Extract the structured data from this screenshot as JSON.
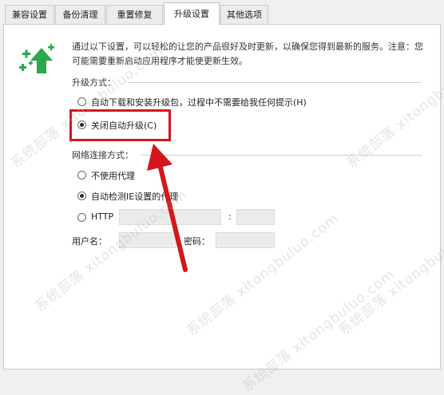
{
  "tabs": [
    {
      "label": "兼容设置"
    },
    {
      "label": "备份清理"
    },
    {
      "label": "重置修复"
    },
    {
      "label": "升级设置"
    },
    {
      "label": "其他选项"
    }
  ],
  "active_tab": "升级设置",
  "description": "通过以下设置，可以轻松的让您的产品很好及时更新，以确保您得到最新的服务。注意：您可能需要重新启动应用程序才能使更新生效。",
  "upgrade": {
    "title": "升级方式：",
    "options": [
      {
        "label": "自动下载和安装升级包，过程中不需要给我任何提示(H)",
        "checked": false
      },
      {
        "label": "关闭自动升级(C)",
        "checked": true
      }
    ]
  },
  "network": {
    "title": "网络连接方式：",
    "options": [
      {
        "label": "不使用代理",
        "checked": false
      },
      {
        "label": "自动检测IE设置的代理",
        "checked": true
      },
      {
        "label": "HTTP",
        "checked": false
      }
    ],
    "port_separator": ":",
    "username_label": "用户名：",
    "password_label": "密码："
  },
  "watermark": "系统部落 xitongbuluo.com",
  "colors": {
    "accent_green": "#2aa84a",
    "highlight_red": "#d4161c"
  },
  "icons": [
    "sparkle-upgrade-icon",
    "arrow-annotation-icon"
  ]
}
